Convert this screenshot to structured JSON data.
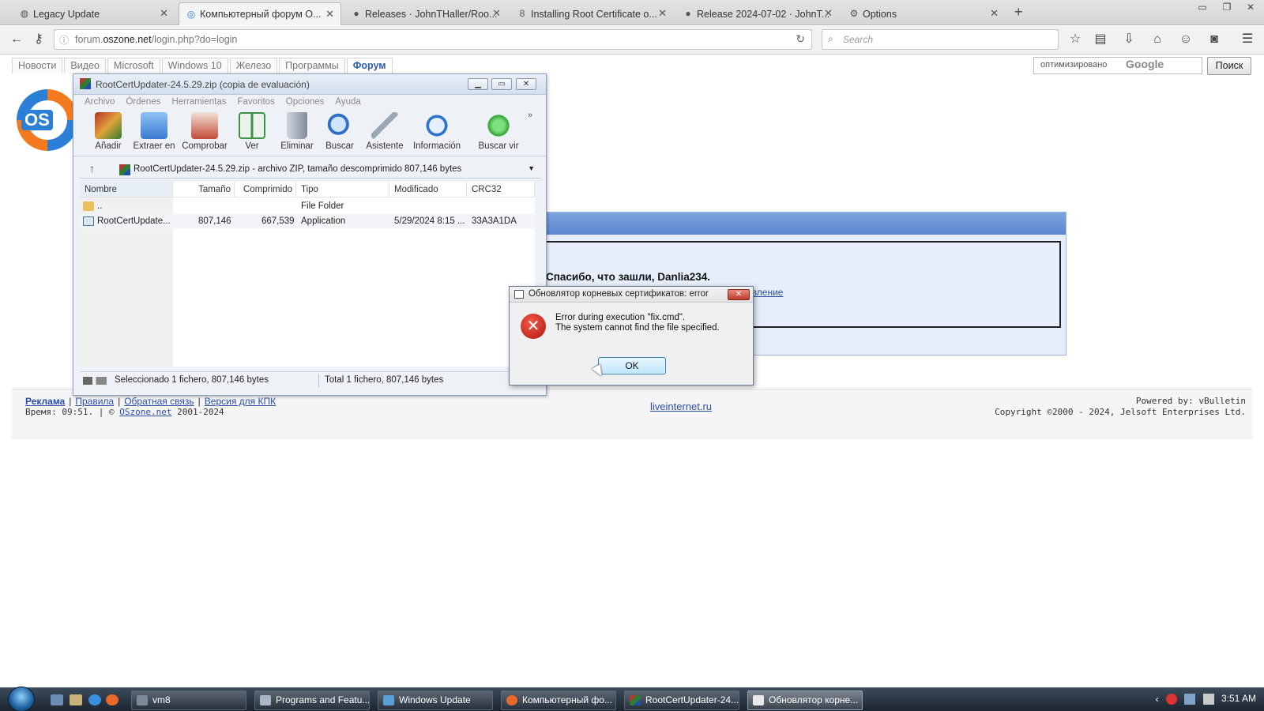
{
  "browser": {
    "tabs": [
      {
        "title": "Legacy Update",
        "icon": "globe-icon",
        "active": false
      },
      {
        "title": "Компьютерный форум O...",
        "icon": "oszone-icon",
        "active": true
      },
      {
        "title": "Releases · JohnTHaller/Roo...",
        "icon": "github-icon",
        "active": false
      },
      {
        "title": "Installing Root Certificate o...",
        "icon": "link-icon",
        "active": false
      },
      {
        "title": "Release 2024-07-02 · JohnT...",
        "icon": "github-icon",
        "active": false
      },
      {
        "title": "Options",
        "icon": "gear-icon",
        "active": false
      }
    ],
    "url_prefix": "forum.",
    "url_domain": "oszone.net",
    "url_path": "/login.php?do=login",
    "search_placeholder": "Search"
  },
  "site": {
    "nav": [
      "Новости",
      "Видео",
      "Microsoft",
      "Windows 10",
      "Железо",
      "Программы",
      "Форум"
    ],
    "active_nav": "Форум",
    "google_label": "оптимизировано",
    "google_brand": "Google",
    "search_button": "Поиск",
    "logo_text": "OS",
    "thanks_text": "Спасибо, что зашли, Danlia234.",
    "panel_link": "авление",
    "footer": {
      "links": [
        "Реклама",
        "Правила",
        "Обратная связь",
        "Версия для КПК"
      ],
      "time_label": "Время: 09:51. | ©",
      "site_link": "OSzone.net",
      "years": "2001-2024",
      "center_link": "liveinternet.ru",
      "powered": "Powered by: vBulletin",
      "copyright": "Copyright ©2000 - 2024, Jelsoft Enterprises Ltd."
    }
  },
  "winrar": {
    "title": "RootCertUpdater-24.5.29.zip (copia de evaluación)",
    "menu": [
      "Archivo",
      "Órdenes",
      "Herramientas",
      "Favoritos",
      "Opciones",
      "Ayuda"
    ],
    "toolbar": [
      {
        "label": "Añadir",
        "icon": "add-archive-icon",
        "color": "#b8322a"
      },
      {
        "label": "Extraer en",
        "icon": "extract-folder-icon",
        "color": "#3b7bd3"
      },
      {
        "label": "Comprobar",
        "icon": "test-clipboard-icon",
        "color": "#c44a3a"
      },
      {
        "label": "Ver",
        "icon": "view-book-icon",
        "color": "#3f8f4a"
      },
      {
        "label": "Eliminar",
        "icon": "trash-icon",
        "color": "#7f8c99"
      },
      {
        "label": "Buscar",
        "icon": "magnifier-icon",
        "color": "#2f6fc7"
      },
      {
        "label": "Asistente",
        "icon": "wizard-wand-icon",
        "color": "#9aa7b4"
      },
      {
        "label": "Información",
        "icon": "info-icon",
        "color": "#2f73d1"
      },
      {
        "label": "Buscar vir",
        "icon": "virus-scan-icon",
        "color": "#2fa335"
      }
    ],
    "path_text": "RootCertUpdater-24.5.29.zip - archivo ZIP, tamaño descomprimido 807,146 bytes",
    "columns": [
      "Nombre",
      "Tamaño",
      "Comprimido",
      "Tipo",
      "Modificado",
      "CRC32"
    ],
    "rows": [
      {
        "name": "..",
        "size": "",
        "packed": "",
        "type": "File Folder",
        "modified": "",
        "crc": ""
      },
      {
        "name": "RootCertUpdate...",
        "size": "807,146",
        "packed": "667,539",
        "type": "Application",
        "modified": "5/29/2024 8:15 ...",
        "crc": "33A3A1DA"
      }
    ],
    "status_left": "Seleccionado 1 fichero, 807,146 bytes",
    "status_right": "Total 1 fichero, 807,146 bytes"
  },
  "dialog": {
    "title": "Обновлятор корневых сертификатов: error",
    "line1": "Error during execution \"fix.cmd\".",
    "line2": "The system cannot find the file specified.",
    "ok": "OK"
  },
  "taskbar": {
    "tasks": [
      {
        "label": "vm8",
        "active": false
      },
      {
        "label": "Programs and Featu...",
        "active": false
      },
      {
        "label": "Windows Update",
        "active": false
      },
      {
        "label": "Компьютерный фо...",
        "active": false
      },
      {
        "label": "RootCertUpdater-24...",
        "active": false
      },
      {
        "label": "Обновлятор корне...",
        "active": true
      }
    ],
    "clock": "3:51 AM"
  }
}
